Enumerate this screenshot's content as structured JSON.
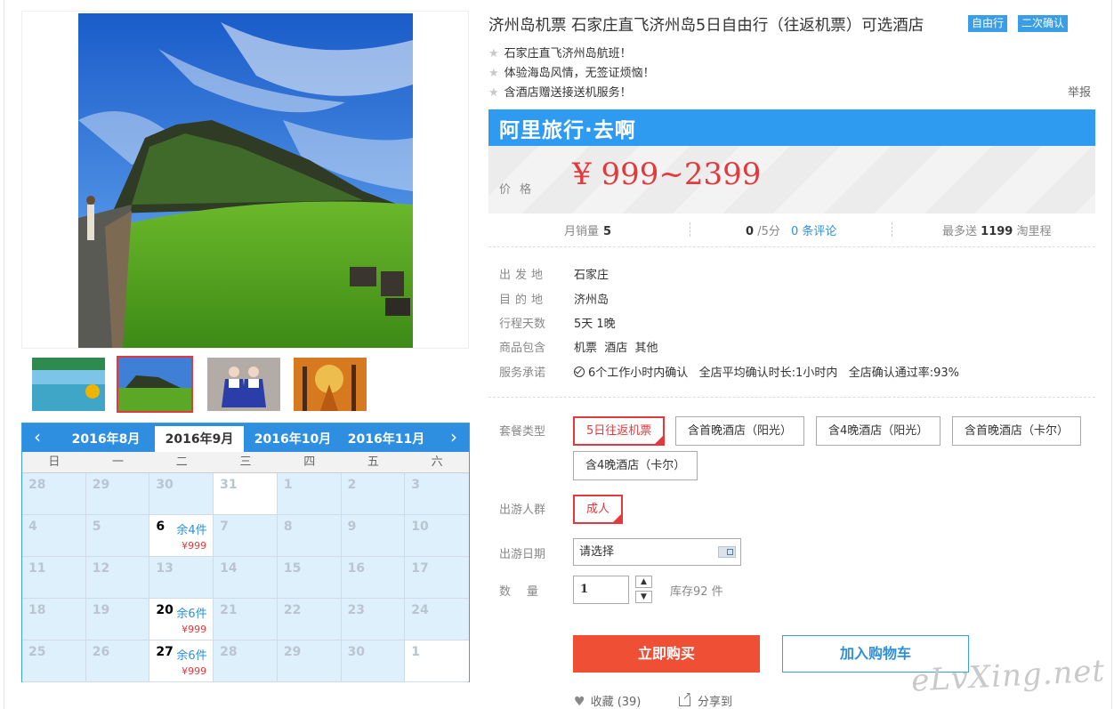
{
  "product": {
    "title": "济州岛机票 石家庄直飞济州岛5日自由行（往返机票）可选酒店",
    "tags": [
      "自由行",
      "二次确认"
    ],
    "features": [
      "石家庄直飞济州岛航班！",
      "体验海岛风情，无签证烦恼！",
      "含酒店赠送接送机服务！"
    ],
    "report_label": "举报"
  },
  "brand": {
    "name": "阿里旅行·去啊"
  },
  "price": {
    "label": "价格",
    "value": "¥ 999~2399"
  },
  "stats": {
    "monthly_sales_label": "月销量",
    "monthly_sales_value": "5",
    "rating_value": "0",
    "rating_suffix": "/5分",
    "reviews_link": "0 条评论",
    "points_prefix": "最多送",
    "points_value": "1199",
    "points_suffix": "淘里程"
  },
  "info": {
    "departure_label": "出发地",
    "departure_value": "石家庄",
    "destination_label": "目的地",
    "destination_value": "济州岛",
    "duration_label": "行程天数",
    "duration_value": "5天 1晚",
    "includes_label": "商品包含",
    "includes_value": "机票  酒店  其他",
    "service_label": "服务承诺",
    "service_value": "6个工作小时内确认   全店平均确认时长:1小时内   全店确认通过率:93%"
  },
  "options": {
    "package_label": "套餐类型",
    "packages": [
      "5日往返机票",
      "含首晚酒店（阳光）",
      "含4晚酒店（阳光）",
      "含首晚酒店（卡尔）",
      "含4晚酒店（卡尔）"
    ],
    "traveler_label": "出游人群",
    "travelers": [
      "成人"
    ],
    "date_label": "出游日期",
    "date_placeholder": "请选择",
    "qty_label": "数量",
    "qty_value": "1",
    "stock_text": "库存92 件"
  },
  "actions": {
    "buy_label": "立即购买",
    "cart_label": "加入购物车",
    "favorite_label": "收藏 (39)",
    "share_label": "分享到"
  },
  "calendar": {
    "months": [
      "2016年8月",
      "2016年9月",
      "2016年10月",
      "2016年11月"
    ],
    "weekdays": [
      "日",
      "一",
      "二",
      "三",
      "四",
      "五",
      "六"
    ],
    "cells": [
      {
        "d": "28"
      },
      {
        "d": "29"
      },
      {
        "d": "30"
      },
      {
        "d": "31"
      },
      {
        "d": "1"
      },
      {
        "d": "2"
      },
      {
        "d": "3"
      },
      {
        "d": "4"
      },
      {
        "d": "5"
      },
      {
        "d": "6",
        "rem": "余4件",
        "price": "¥999"
      },
      {
        "d": "7"
      },
      {
        "d": "8"
      },
      {
        "d": "9"
      },
      {
        "d": "10"
      },
      {
        "d": "11"
      },
      {
        "d": "12"
      },
      {
        "d": "13"
      },
      {
        "d": "14"
      },
      {
        "d": "15"
      },
      {
        "d": "16"
      },
      {
        "d": "17"
      },
      {
        "d": "18"
      },
      {
        "d": "19"
      },
      {
        "d": "20",
        "rem": "余6件",
        "price": "¥999"
      },
      {
        "d": "21"
      },
      {
        "d": "22"
      },
      {
        "d": "23"
      },
      {
        "d": "24"
      },
      {
        "d": "25"
      },
      {
        "d": "26"
      },
      {
        "d": "27",
        "rem": "余6件",
        "price": "¥999"
      },
      {
        "d": "28"
      },
      {
        "d": "29"
      },
      {
        "d": "30"
      },
      {
        "d": "1"
      }
    ]
  },
  "watermark": "eLvXing.net",
  "colors": {
    "accent": "#2e8fe0",
    "price": "#e4393c",
    "buy": "#ef4f35"
  }
}
